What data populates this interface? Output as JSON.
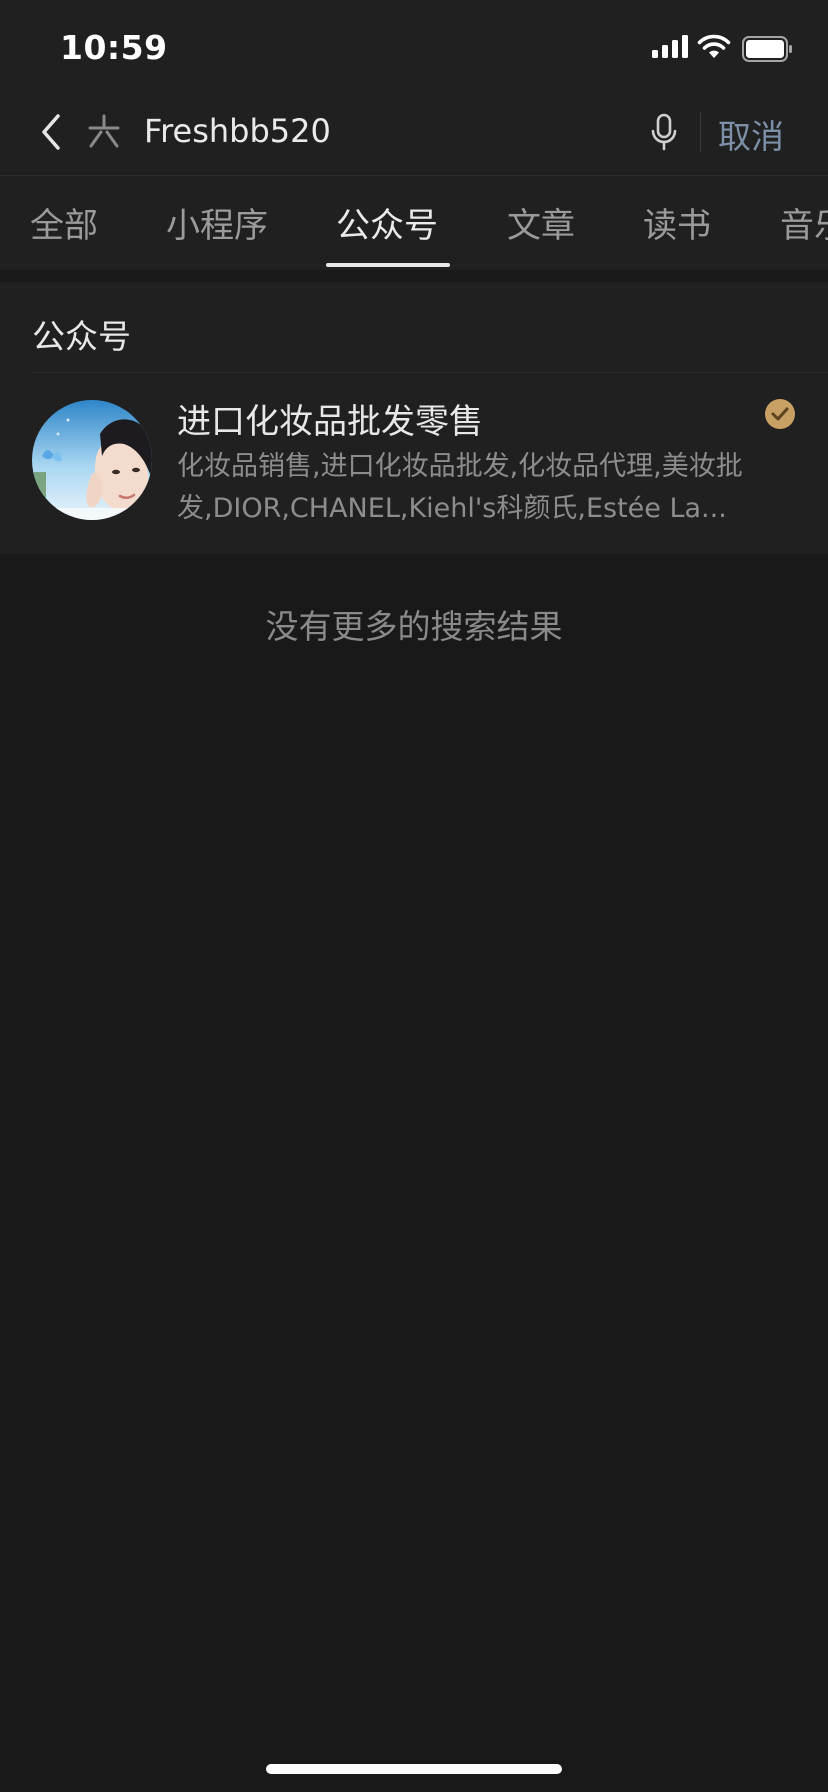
{
  "status_bar": {
    "time": "10:59"
  },
  "search": {
    "query": "Freshbb520",
    "cancel_label": "取消"
  },
  "tabs": [
    {
      "label": "全部",
      "active": false
    },
    {
      "label": "小程序",
      "active": false
    },
    {
      "label": "公众号",
      "active": true
    },
    {
      "label": "文章",
      "active": false
    },
    {
      "label": "读书",
      "active": false
    },
    {
      "label": "音乐",
      "active": false
    }
  ],
  "results": {
    "section_title": "公众号",
    "account": {
      "name": "进口化妆品批发零售",
      "description": "化妆品销售,进口化妆品批发,化妆品代理,美妆批发,DIOR,CHANEL,Kiehl's科颜氏,Estée La...",
      "verified": true
    }
  },
  "footer": {
    "no_more_text": "没有更多的搜索结果"
  },
  "colors": {
    "background": "#191919",
    "panel": "#202020",
    "accent_link": "#7d90a9",
    "verified_gold": "#c9a063"
  }
}
